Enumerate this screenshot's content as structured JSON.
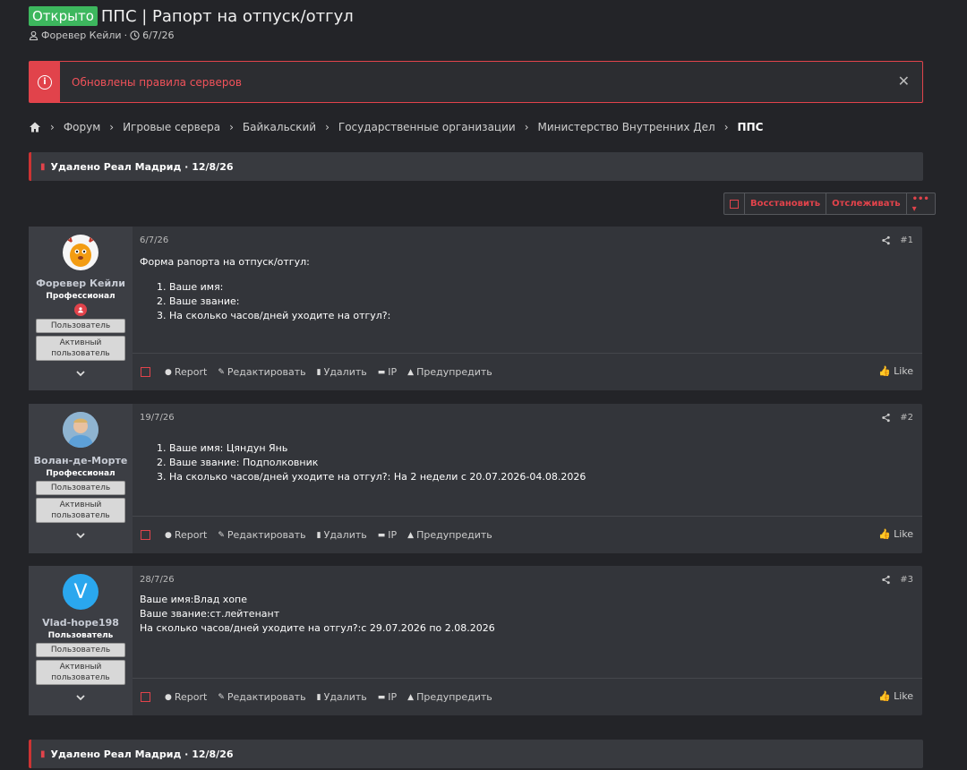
{
  "thread": {
    "status_badge": "Открыто",
    "title": "ППС | Рапорт на отпуск/отгул",
    "author": "Форевер Кейли",
    "date": "6/7/26"
  },
  "notice": {
    "text": "Обновлены правила серверов",
    "close": "✕"
  },
  "breadcrumb": {
    "items": [
      "Форум",
      "Игровые сервера",
      "Байкальский",
      "Государственные организации",
      "Министерство Внутренних Дел",
      "ППС"
    ],
    "separator": "›"
  },
  "deleted_top": "Удалено Реал Мадрид · 12/8/26",
  "deleted_bottom": "Удалено Реал Мадрид · 12/8/26",
  "actions": {
    "restore": "Восстановить",
    "watch": "Отслеживать",
    "more": "••• ▾"
  },
  "footer_labels": {
    "report": "Report",
    "edit": "Редактировать",
    "delete": "Удалить",
    "ip": "IP",
    "warn": "Предупредить",
    "like": "Like"
  },
  "posts": [
    {
      "username": "Форевер Кейли",
      "title": "Профессионал",
      "badge1": "Пользователь",
      "badge2": "Активный пользователь",
      "date": "6/7/26",
      "number": "#1",
      "intro": "Форма рапорта на отпуск/отгул:",
      "lines": [
        "Ваше имя:",
        "Ваше звание:",
        "На сколько часов/дней уходите на отгул?:"
      ]
    },
    {
      "username": "Волан-де-Морте",
      "title": "Профессионал",
      "badge1": "Пользователь",
      "badge2": "Активный пользователь",
      "date": "19/7/26",
      "number": "#2",
      "lines": [
        "Ваше имя: Цяндун Янь",
        "Ваше звание: Подполковник",
        "На сколько часов/дней уходите на отгул?: На 2 недели с 20.07.2026-04.08.2026"
      ]
    },
    {
      "username": "Vlad-hope198",
      "title": "Пользователь",
      "badge1": "Пользователь",
      "badge2": "Активный пользователь",
      "avatar_letter": "V",
      "date": "28/7/26",
      "number": "#3",
      "lines": [
        "Ваше имя:Влад хопе",
        "Ваше звание:ст.лейтенант",
        "На сколько часов/дней уходите на отгул?:с 29.07.2026 по 2.08.2026"
      ]
    }
  ],
  "colors": {
    "accent_red": "#e1434b",
    "open_green": "#3db75e",
    "avatar_blue": "#2aa7ee"
  }
}
